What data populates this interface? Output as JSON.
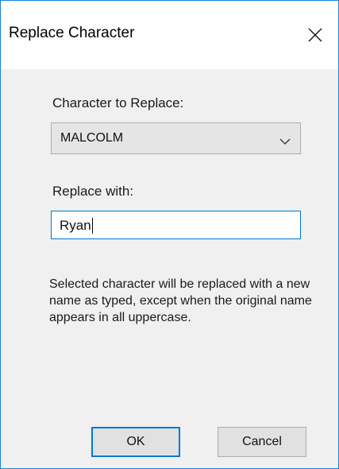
{
  "dialog": {
    "title": "Replace Character",
    "close_icon": "close-icon"
  },
  "form": {
    "character_label": "Character to Replace:",
    "character_value": "MALCOLM",
    "dropdown_icon": "chevron-down-icon",
    "replace_label": "Replace with:",
    "replace_value": "Ryan",
    "description": "Selected character will be replaced with a new name as typed, except when the original name appears in all uppercase."
  },
  "buttons": {
    "ok_label": "OK",
    "cancel_label": "Cancel"
  },
  "colors": {
    "accent": "#0078d7",
    "window_border": "#1883d7",
    "client_background": "#f0f0f0"
  }
}
